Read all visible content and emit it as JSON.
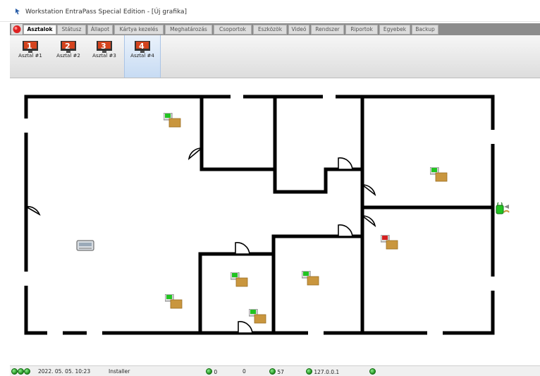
{
  "window": {
    "title": "Workstation EntraPass Special Edition - [Új grafika]"
  },
  "tabs": [
    {
      "label": "Asztalok",
      "active": true
    },
    {
      "label": "Státusz"
    },
    {
      "label": "Állapot"
    },
    {
      "label": "Kártya kezelés"
    },
    {
      "label": "Meghatározás"
    },
    {
      "label": "Csoportok"
    },
    {
      "label": "Eszközök"
    },
    {
      "label": "Videó"
    },
    {
      "label": "Rendszer"
    },
    {
      "label": "Riportok"
    },
    {
      "label": "Egyebek"
    },
    {
      "label": "Backup"
    }
  ],
  "desktops": [
    {
      "label": "Asztal #1",
      "number": "1"
    },
    {
      "label": "Asztal #2",
      "number": "2"
    },
    {
      "label": "Asztal #3",
      "number": "3"
    },
    {
      "label": "Asztal #4",
      "number": "4",
      "active": true
    }
  ],
  "floorplan": {
    "doors": [
      {
        "name": "door-room-1",
        "state": "normal"
      },
      {
        "name": "door-room-2",
        "state": "normal"
      },
      {
        "name": "door-room-3",
        "state": "normal"
      },
      {
        "name": "door-room-4",
        "state": "normal"
      },
      {
        "name": "door-room-5",
        "state": "alarm"
      },
      {
        "name": "door-room-6",
        "state": "normal"
      },
      {
        "name": "door-room-7",
        "state": "normal"
      },
      {
        "name": "door-room-8",
        "state": "normal"
      }
    ],
    "colors": {
      "ok": "#22c422",
      "alarm": "#d42020",
      "wall": "#000000"
    }
  },
  "status": {
    "datetime": "2022. 05. 05. 10:23",
    "user": "Installer",
    "count_a": "0",
    "count_b": "0",
    "count_c": "57",
    "ip": "127.0.0.1"
  }
}
